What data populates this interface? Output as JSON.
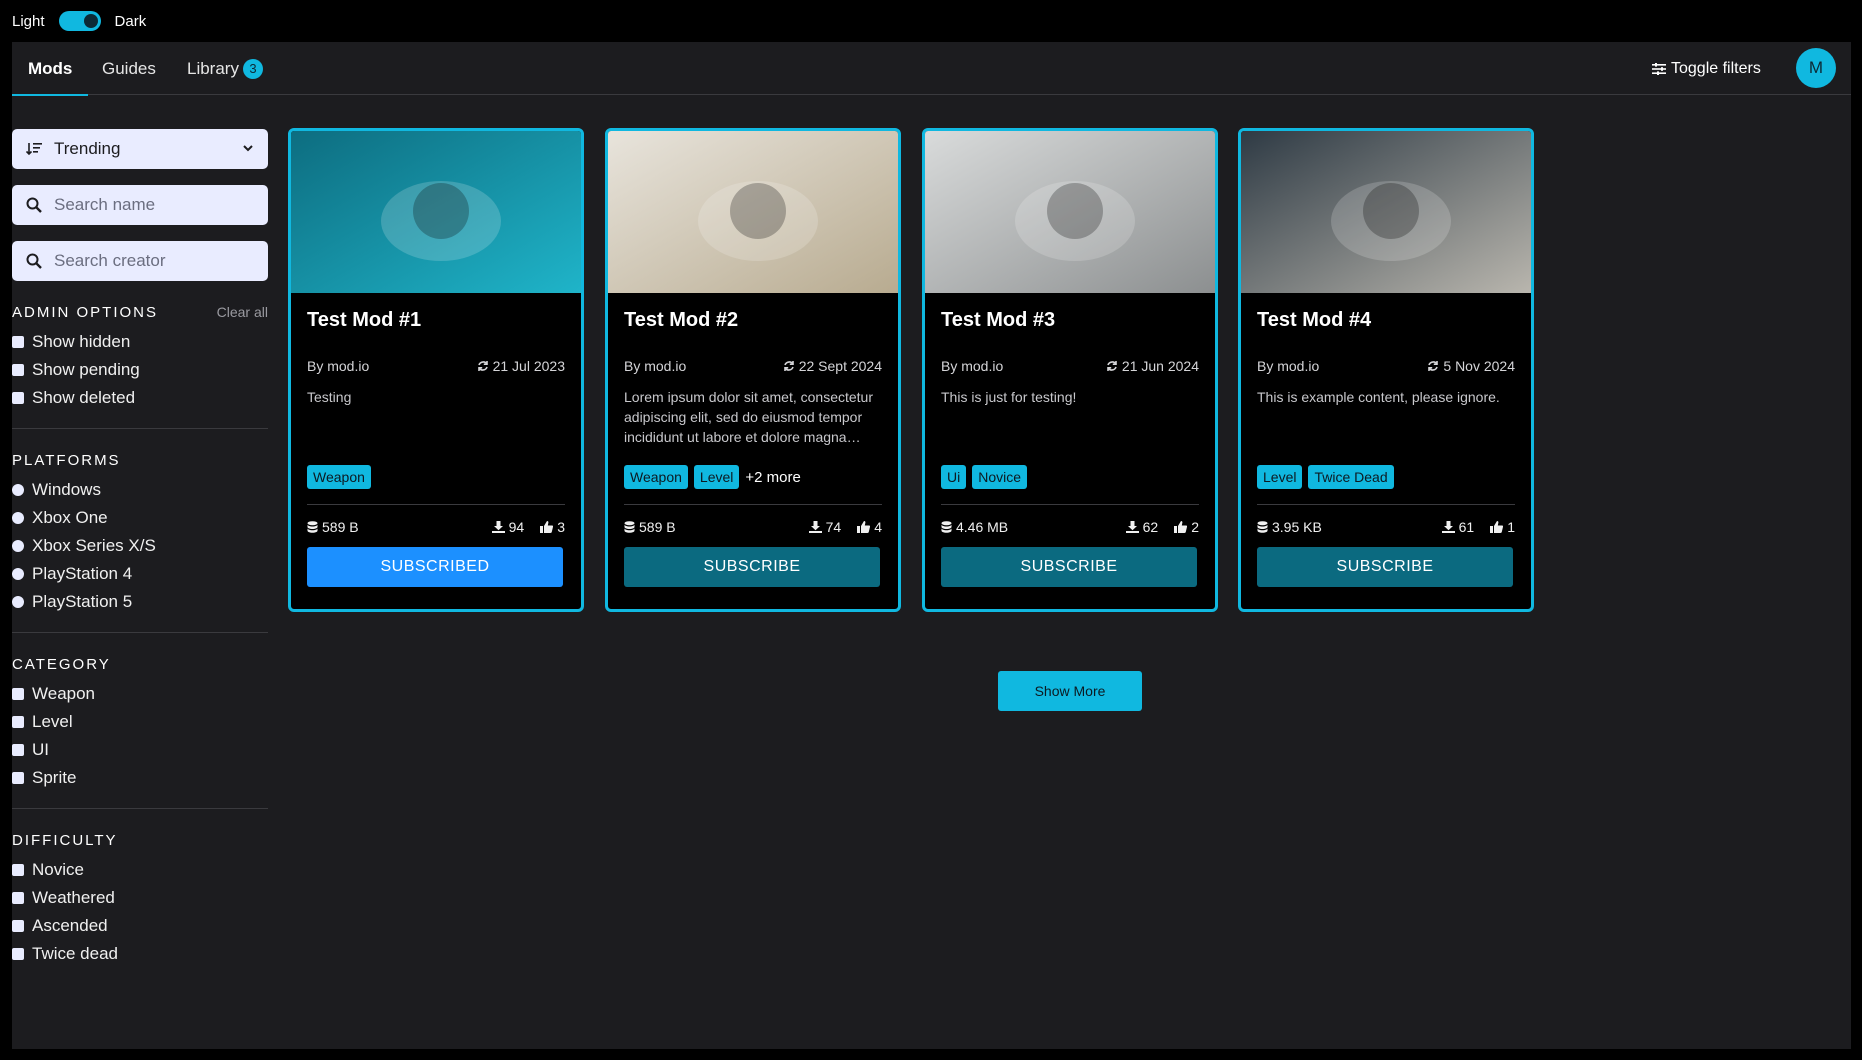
{
  "theme": {
    "light_label": "Light",
    "dark_label": "Dark"
  },
  "nav": {
    "tabs": [
      {
        "label": "Mods"
      },
      {
        "label": "Guides"
      },
      {
        "label": "Library",
        "badge": "3"
      }
    ],
    "toggle_filters": "Toggle filters",
    "avatar_initial": "M"
  },
  "sidebar": {
    "sort_value": "Trending",
    "search_name_placeholder": "Search name",
    "search_creator_placeholder": "Search creator",
    "admin": {
      "title": "ADMIN OPTIONS",
      "clear": "Clear all",
      "items": [
        "Show hidden",
        "Show pending",
        "Show deleted"
      ]
    },
    "platforms": {
      "title": "PLATFORMS",
      "items": [
        "Windows",
        "Xbox One",
        "Xbox Series X/S",
        "PlayStation 4",
        "PlayStation 5"
      ]
    },
    "category": {
      "title": "CATEGORY",
      "items": [
        "Weapon",
        "Level",
        "UI",
        "Sprite"
      ]
    },
    "difficulty": {
      "title": "DIFFICULTY",
      "items": [
        "Novice",
        "Weathered",
        "Ascended",
        "Twice dead"
      ]
    }
  },
  "mods": [
    {
      "title": "Test Mod #1",
      "author": "By mod.io",
      "date": "21 Jul 2023",
      "description": "Testing",
      "tags": [
        "Weapon"
      ],
      "more": "",
      "size": "589 B",
      "downloads": "94",
      "likes": "3",
      "button": "SUBSCRIBED",
      "subscribed": true,
      "image_colors": [
        "#0d6d80",
        "#1fb4c9"
      ]
    },
    {
      "title": "Test Mod #2",
      "author": "By mod.io",
      "date": "22 Sept 2024",
      "description": "Lorem ipsum dolor sit amet, consectetur adipiscing elit, sed do eiusmod tempor incididunt ut labore et dolore magna aliqua.",
      "tags": [
        "Weapon",
        "Level"
      ],
      "more": "+2 more",
      "size": "589 B",
      "downloads": "74",
      "likes": "4",
      "button": "SUBSCRIBE",
      "subscribed": false,
      "image_colors": [
        "#e8e4dc",
        "#b8ab90"
      ]
    },
    {
      "title": "Test Mod #3",
      "author": "By mod.io",
      "date": "21 Jun 2024",
      "description": "This is just for testing!",
      "tags": [
        "Ui",
        "Novice"
      ],
      "more": "",
      "size": "4.46 MB",
      "downloads": "62",
      "likes": "2",
      "button": "SUBSCRIBE",
      "subscribed": false,
      "image_colors": [
        "#d9dbdb",
        "#8c8f90"
      ]
    },
    {
      "title": "Test Mod #4",
      "author": "By mod.io",
      "date": "5 Nov 2024",
      "description": "This is example content, please ignore.",
      "tags": [
        "Level",
        "Twice Dead"
      ],
      "more": "",
      "size": "3.95 KB",
      "downloads": "61",
      "likes": "1",
      "button": "SUBSCRIBE",
      "subscribed": false,
      "image_colors": [
        "#2e3a44",
        "#b9b6ae"
      ]
    }
  ],
  "show_more": "Show More"
}
